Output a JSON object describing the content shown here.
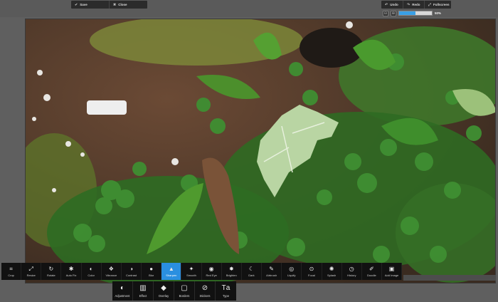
{
  "top_left": {
    "save_label": "Save",
    "close_label": "Close"
  },
  "top_right": {
    "undo_label": "Undo",
    "redo_label": "Redo",
    "fullscreen_label": "Fullscreen"
  },
  "zoom": {
    "value_label": "50%",
    "level": 0.5
  },
  "tools": [
    {
      "label": "Crop",
      "icon": "crop-icon",
      "glyph": "⌗"
    },
    {
      "label": "Resize",
      "icon": "resize-icon",
      "glyph": "⤢"
    },
    {
      "label": "Rotate",
      "icon": "rotate-icon",
      "glyph": "↻"
    },
    {
      "label": "Auto Fix",
      "icon": "auto-fix-icon",
      "glyph": "✱"
    },
    {
      "label": "Color",
      "icon": "color-icon",
      "glyph": "◐"
    },
    {
      "label": "Vibrance",
      "icon": "vibrance-icon",
      "glyph": "❖"
    },
    {
      "label": "Contrast",
      "icon": "contrast-icon",
      "glyph": "◑"
    },
    {
      "label": "Blur",
      "icon": "blur-icon",
      "glyph": "●"
    },
    {
      "label": "Sharpen",
      "icon": "sharpen-icon",
      "glyph": "▲"
    },
    {
      "label": "Smooth",
      "icon": "smooth-icon",
      "glyph": "✦"
    },
    {
      "label": "Red Eye",
      "icon": "red-eye-icon",
      "glyph": "◉"
    },
    {
      "label": "Brighten",
      "icon": "brighten-icon",
      "glyph": "✸"
    },
    {
      "label": "Dark",
      "icon": "dark-icon",
      "glyph": "☾"
    },
    {
      "label": "Airbrush",
      "icon": "airbrush-icon",
      "glyph": "✎"
    },
    {
      "label": "Liquify",
      "icon": "liquify-icon",
      "glyph": "◎"
    },
    {
      "label": "Focal",
      "icon": "focal-icon",
      "glyph": "⊙"
    },
    {
      "label": "Splash",
      "icon": "splash-icon",
      "glyph": "✺"
    },
    {
      "label": "History",
      "icon": "history-icon",
      "glyph": "◷"
    },
    {
      "label": "Doodle",
      "icon": "doodle-icon",
      "glyph": "✐"
    },
    {
      "label": "Add Image",
      "icon": "add-image-icon",
      "glyph": "▣"
    }
  ],
  "active_tool": "Sharpen",
  "categories": [
    {
      "label": "Adjustment",
      "icon": "adjustment-icon",
      "glyph": "◐"
    },
    {
      "label": "Effect",
      "icon": "effect-icon",
      "glyph": "▥"
    },
    {
      "label": "Overlay",
      "icon": "overlay-icon",
      "glyph": "◆"
    },
    {
      "label": "Borders",
      "icon": "borders-icon",
      "glyph": "▢"
    },
    {
      "label": "Stickers",
      "icon": "stickers-icon",
      "glyph": "⊘"
    },
    {
      "label": "Type",
      "icon": "type-icon",
      "glyph": "Tа"
    }
  ],
  "colors": {
    "accent": "#2a8fe0",
    "toolbar_bg": "#111111",
    "workspace_bg": "#5f5f5f"
  }
}
